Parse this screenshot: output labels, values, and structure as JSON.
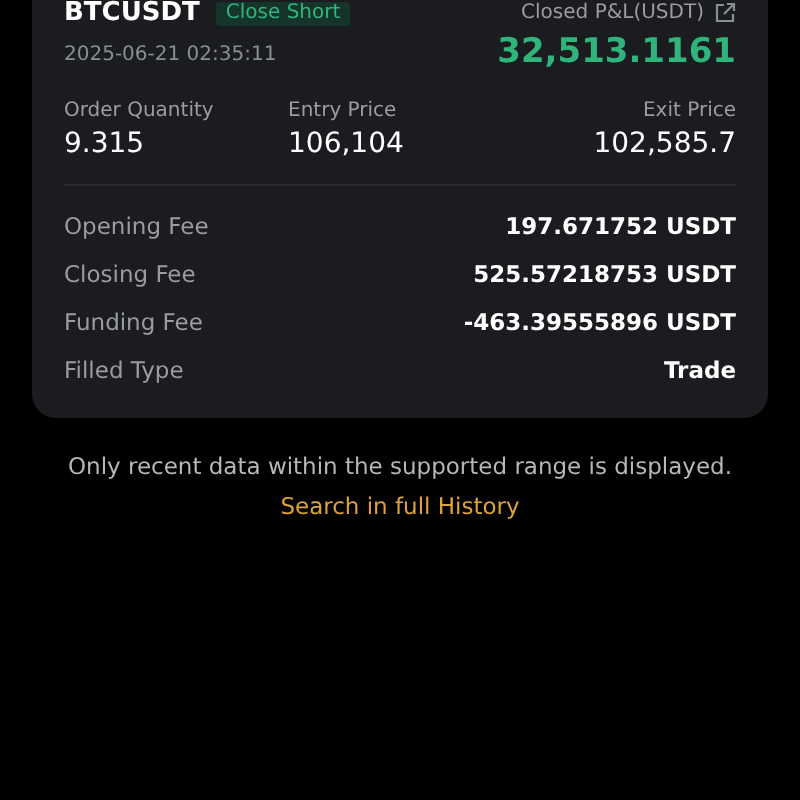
{
  "order": {
    "symbol": "BTCUSDT",
    "side_badge": "Close Short",
    "time": "2025-06-21 02:35:11",
    "pnl_label": "Closed P&L(USDT)",
    "pnl_value": "32,513.1161"
  },
  "stats": [
    {
      "label": "Order Quantity",
      "value": "9.315"
    },
    {
      "label": "Entry Price",
      "value": "106,104"
    },
    {
      "label": "Exit Price",
      "value": "102,585.7"
    }
  ],
  "details": [
    {
      "label": "Opening Fee",
      "value": "197.671752 USDT"
    },
    {
      "label": "Closing Fee",
      "value": "525.57218753 USDT"
    },
    {
      "label": "Funding Fee",
      "value": "-463.39555896 USDT"
    },
    {
      "label": "Filled Type",
      "value": "Trade"
    }
  ],
  "notice": "Only recent data within the supported range is displayed.",
  "history_link": "Search in full History"
}
